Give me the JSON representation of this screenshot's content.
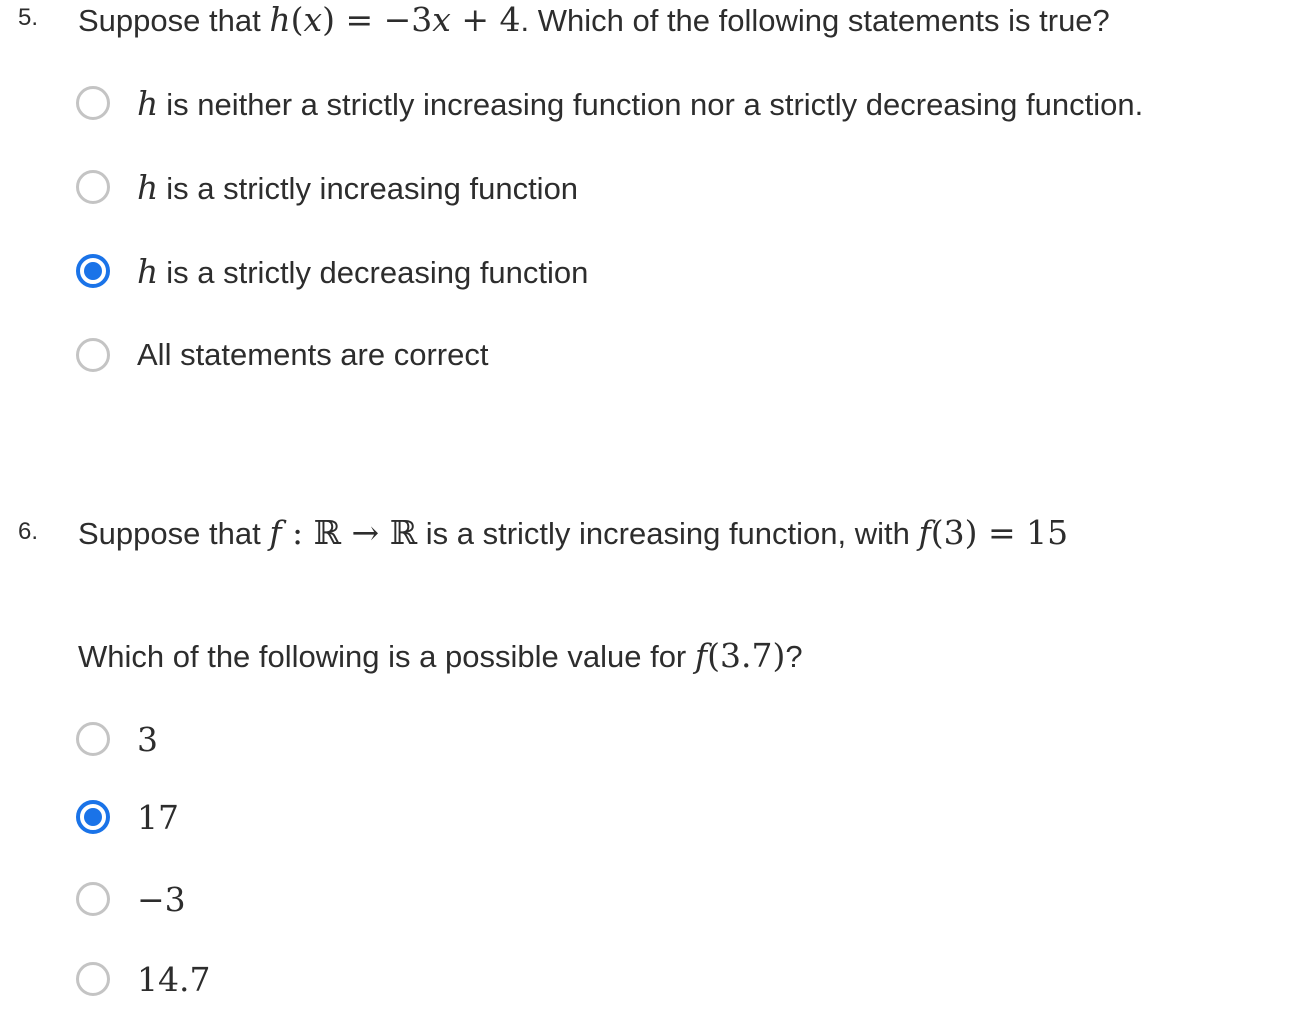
{
  "q5": {
    "number": "5.",
    "text_before": "Suppose that ",
    "math_fn": "h",
    "math_arg": "x",
    "math_rhs_coef": " = −3",
    "math_rhs_var": "x",
    "math_rhs_const": " + 4",
    "text_after": ". Which of the following statements is true?",
    "options": [
      {
        "math": "h",
        "text": "is neither a strictly increasing function nor a strictly decreasing function.",
        "selected": false
      },
      {
        "math": "h",
        "text": "is a strictly increasing function",
        "selected": false
      },
      {
        "math": "h",
        "text": "is a strictly decreasing function",
        "selected": true
      },
      {
        "math": "",
        "text": "All statements are correct",
        "selected": false
      }
    ]
  },
  "q6": {
    "number": "6.",
    "text_before": "Suppose that ",
    "math_fn": "f",
    "math_map": " : ℝ → ℝ",
    "text_mid": " is a strictly increasing function, with ",
    "math_eval": "(3) = 15",
    "prompt_before": "Which of the following is a possible value for ",
    "prompt_math": "(3.7)",
    "prompt_after": "?",
    "options": [
      {
        "text": "3",
        "selected": false
      },
      {
        "text": "17",
        "selected": true
      },
      {
        "text": "−3",
        "selected": false
      },
      {
        "text": "14.7",
        "selected": false
      }
    ]
  },
  "colors": {
    "accent": "#1a73e8",
    "radio_border": "#c4c4c4",
    "text": "#2d2d2d"
  }
}
